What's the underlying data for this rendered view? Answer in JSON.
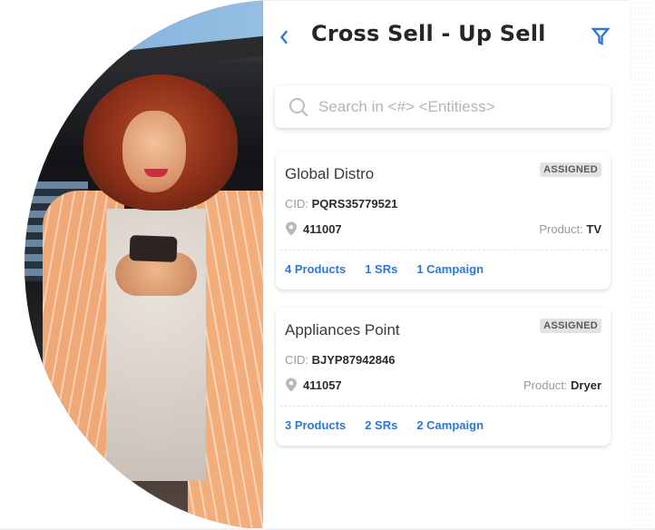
{
  "app": {
    "title": "Cross Sell - Up Sell",
    "accent_color": "#2f76d9"
  },
  "header": {
    "back_icon": "chevron-left-icon",
    "filter_icon": "filter-icon"
  },
  "search": {
    "placeholder": "Search in <#> <Entitiess>",
    "value": "",
    "icon": "search-icon"
  },
  "cards": [
    {
      "name": "Global Distro",
      "status": "ASSIGNED",
      "cid_label": "CID: ",
      "cid": "PQRS35779521",
      "pincode": "411007",
      "product_label": "Product: ",
      "product": "TV",
      "links": [
        "4 Products",
        "1 SRs",
        "1 Campaign"
      ]
    },
    {
      "name": "Appliances Point",
      "status": "ASSIGNED",
      "cid_label": "CID: ",
      "cid": "BJYP87942846",
      "pincode": "411057",
      "product_label": "Product: ",
      "product": "Dryer",
      "links": [
        "3 Products",
        "2 SRs",
        "2 Campaign"
      ]
    }
  ],
  "hero_image": {
    "description": "Woman with curly red hair smiling at her smartphone"
  }
}
